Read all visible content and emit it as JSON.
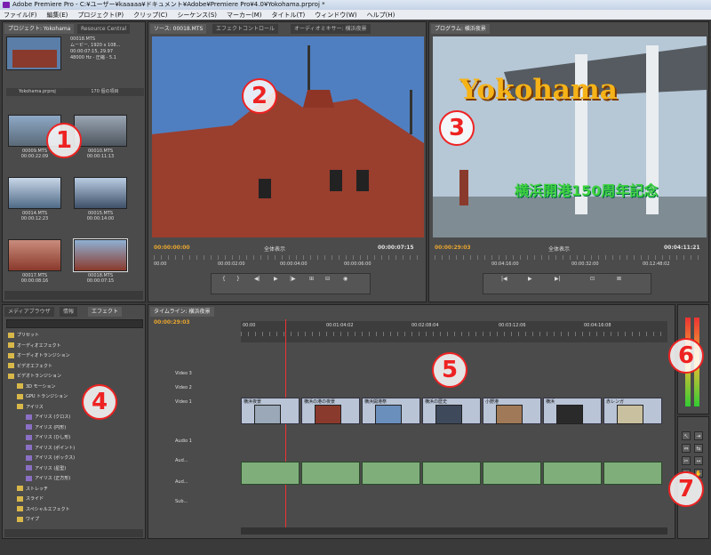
{
  "window": {
    "title": "Adobe Premiere Pro - C:¥ユーザー¥kaaaaa¥ドキュメント¥Adobe¥Premiere Pro¥4.0¥Yokohama.prproj *"
  },
  "menu": [
    "ファイル(F)",
    "編集(E)",
    "プロジェクト(P)",
    "クリップ(C)",
    "シーケンス(S)",
    "マーカー(M)",
    "タイトル(T)",
    "ウィンドウ(W)",
    "ヘルプ(H)"
  ],
  "project": {
    "tabs": [
      "プロジェクト: Yokohama",
      "Resource Central"
    ],
    "info": {
      "name": "00018.MTS",
      "type": "ムービー, 1920 x 108...",
      "duration": "00:00:07:15, 29.97",
      "audio": "48000 Hz - 圧縮 - 5.1"
    },
    "bin_name": "Yokohama.prproj",
    "item_count": "170 個の項目",
    "clips": [
      {
        "name": "00009.MTS",
        "dur": "00:00:22:09"
      },
      {
        "name": "00010.MTS",
        "dur": "00:00:11:13"
      },
      {
        "name": "00014.MTS",
        "dur": "00:00:12:23"
      },
      {
        "name": "00015.MTS",
        "dur": "00:00:14:00"
      },
      {
        "name": "00017.MTS",
        "dur": "00:00:08:16"
      },
      {
        "name": "00018.MTS",
        "dur": "00:00:07:15"
      }
    ]
  },
  "source": {
    "tabs": [
      "ソース: 00018.MTS",
      "エフェクトコントロール",
      "オーディオミキサー: 横浜夜景"
    ],
    "tc_in": "00:00:00:00",
    "tc_out": "00:00:07:15",
    "fit": "全体表示",
    "ruler": [
      "00:00",
      "00:00:02:00",
      "00:00:04:00",
      "00:00:06:00"
    ]
  },
  "program": {
    "tabs": [
      "プログラム: 横浜夜景"
    ],
    "title_text": "Yokohama",
    "subtitle_text": "横浜開港150周年記念",
    "tc_in": "00:00:29:03",
    "tc_out": "00:04:11:21",
    "fit": "全体表示",
    "ruler": [
      "00:04:16:00",
      "00:00:32:00",
      "00:12:48:02"
    ]
  },
  "effects": {
    "tabs": [
      "メディアブラウザ",
      "情報",
      "エフェクト"
    ],
    "tree": [
      {
        "label": "プリセット",
        "type": "folder",
        "indent": 0
      },
      {
        "label": "オーディオエフェクト",
        "type": "folder",
        "indent": 0
      },
      {
        "label": "オーディオトランジション",
        "type": "folder",
        "indent": 0
      },
      {
        "label": "ビデオエフェクト",
        "type": "folder",
        "indent": 0
      },
      {
        "label": "ビデオトランジション",
        "type": "folder",
        "indent": 0
      },
      {
        "label": "3D モーション",
        "type": "folder",
        "indent": 1
      },
      {
        "label": "GPU トランジション",
        "type": "folder",
        "indent": 1
      },
      {
        "label": "アイリス",
        "type": "folder",
        "indent": 1
      },
      {
        "label": "アイリス (クロス)",
        "type": "effect",
        "indent": 2
      },
      {
        "label": "アイリス (円形)",
        "type": "effect",
        "indent": 2
      },
      {
        "label": "アイリス (ひし形)",
        "type": "effect",
        "indent": 2
      },
      {
        "label": "アイリス (ポイント)",
        "type": "effect",
        "indent": 2
      },
      {
        "label": "アイリス (ボックス)",
        "type": "effect",
        "indent": 2
      },
      {
        "label": "アイリス (星型)",
        "type": "effect",
        "indent": 2
      },
      {
        "label": "アイリス (正方形)",
        "type": "effect",
        "indent": 2
      },
      {
        "label": "ストレッチ",
        "type": "folder",
        "indent": 1
      },
      {
        "label": "スライド",
        "type": "folder",
        "indent": 1
      },
      {
        "label": "スペシャルエフェクト",
        "type": "folder",
        "indent": 1
      },
      {
        "label": "ワイプ",
        "type": "folder",
        "indent": 1
      }
    ]
  },
  "timeline": {
    "tab": "タイムライン: 横浜夜景",
    "tc": "00:00:29:03",
    "ruler": [
      "00:00",
      "00:01:04:02",
      "00:02:08:04",
      "00:03:12:06",
      "00:04:16:08"
    ],
    "tracks": [
      "Video 3",
      "Video 2",
      "Video 1",
      "Audio 1",
      "Aud...",
      "Aud...",
      "Sub..."
    ],
    "clip_labels": [
      "横浜夜景",
      "横浜の港の夜景",
      "横浜開港祭",
      "横浜の歴史",
      "小野港",
      "横浜",
      "赤レンガ"
    ]
  },
  "markers": [
    "1",
    "2",
    "3",
    "4",
    "5",
    "6",
    "7"
  ],
  "colors": {
    "accent": "#e22222",
    "timecode": "#e8a630"
  }
}
